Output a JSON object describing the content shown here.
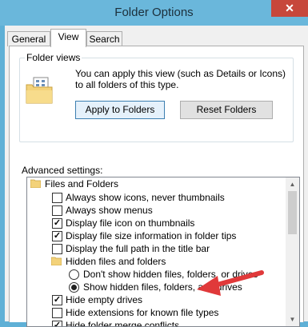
{
  "window": {
    "title": "Folder Options",
    "close_glyph": "✕"
  },
  "tabs": [
    {
      "label": "General"
    },
    {
      "label": "View"
    },
    {
      "label": "Search"
    }
  ],
  "folder_views": {
    "label": "Folder views",
    "description": "You can apply this view (such as Details or Icons) to all folders of this type.",
    "apply_button": "Apply to Folders",
    "reset_button": "Reset Folders"
  },
  "advanced": {
    "label": "Advanced settings:",
    "items": [
      {
        "type": "folder",
        "label": "Files and Folders"
      },
      {
        "type": "checkbox",
        "checked": false,
        "label": "Always show icons, never thumbnails"
      },
      {
        "type": "checkbox",
        "checked": false,
        "label": "Always show menus"
      },
      {
        "type": "checkbox",
        "checked": true,
        "label": "Display file icon on thumbnails"
      },
      {
        "type": "checkbox",
        "checked": true,
        "label": "Display file size information in folder tips"
      },
      {
        "type": "checkbox",
        "checked": false,
        "label": "Display the full path in the title bar"
      },
      {
        "type": "folder",
        "label": "Hidden files and folders"
      },
      {
        "type": "radio",
        "checked": false,
        "label": "Don't show hidden files, folders, or drives"
      },
      {
        "type": "radio",
        "checked": true,
        "label": "Show hidden files, folders, and drives"
      },
      {
        "type": "checkbox",
        "checked": true,
        "label": "Hide empty drives"
      },
      {
        "type": "checkbox",
        "checked": false,
        "label": "Hide extensions for known file types"
      },
      {
        "type": "checkbox",
        "checked": true,
        "label": "Hide folder merge conflicts"
      }
    ]
  },
  "scrollbar": {
    "up_glyph": "▲",
    "down_glyph": "▼"
  },
  "check_glyph": "✓",
  "colors": {
    "annotation_arrow": "#e0393a",
    "title_bar": "#6ab7db",
    "close_button": "#c7473b"
  }
}
